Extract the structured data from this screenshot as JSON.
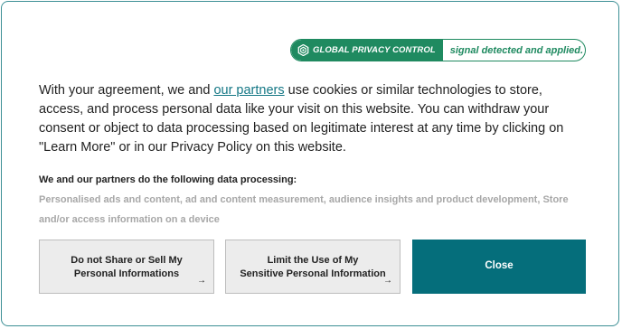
{
  "gpc": {
    "label": "GLOBAL PRIVACY CONTROL",
    "status": "signal detected and applied.",
    "color": "#1f8a60"
  },
  "intro": {
    "before_link": "With your agreement, we and ",
    "link_text": "our partners",
    "after_link": " use cookies or similar technologies to store, access, and process personal data like your visit on this website. You can withdraw your consent or object to data processing based on legitimate interest at any time by clicking on \"Learn More\" or in our Privacy Policy on this website."
  },
  "processing": {
    "title": "We and our partners do the following data processing:",
    "list": "Personalised ads and content, ad and content measurement, audience insights and product development, Store and/or access information on a device"
  },
  "buttons": {
    "do_not_sell": "Do not Share or Sell My\nPersonal Informations",
    "limit_use": "Limit the Use of My\nSensitive Personal Information",
    "close": "Close",
    "arrow": "→"
  },
  "colors": {
    "accent": "#056e7b",
    "link": "#147785",
    "border": "#3c8f95"
  }
}
